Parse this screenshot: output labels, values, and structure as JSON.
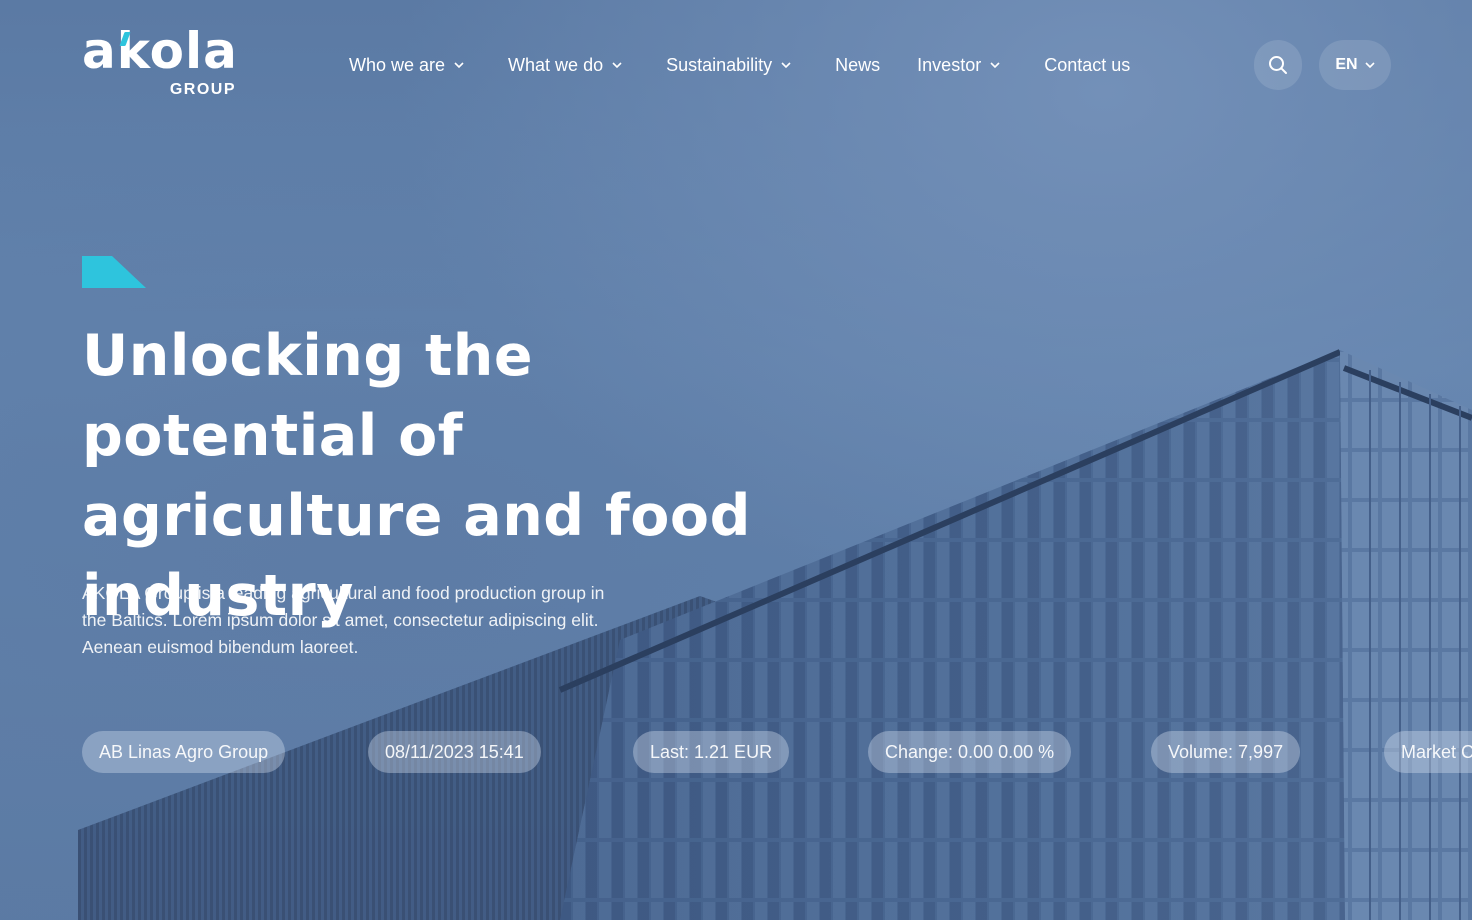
{
  "brand": {
    "logo_text": "akola",
    "logo_sub": "GROUP",
    "accent_color": "#2ec4dd"
  },
  "nav": {
    "items": [
      {
        "label": "Who we are",
        "dropdown": true
      },
      {
        "label": "What we do",
        "dropdown": true
      },
      {
        "label": "Sustainability",
        "dropdown": true
      },
      {
        "label": "News",
        "dropdown": false
      },
      {
        "label": "Investor",
        "dropdown": true
      },
      {
        "label": "Contact us",
        "dropdown": false
      }
    ],
    "search_icon": "search-icon",
    "language": "EN"
  },
  "hero": {
    "headline": "Unlocking the potential of agriculture and food industry",
    "intro": "AKOLA Group is a leading agricultural and food production group in the Baltics. Lorem ipsum dolor sit amet, consectetur adipiscing elit. Aenean euismod bibendum laoreet."
  },
  "ticker": {
    "company": "AB Linas Agro Group",
    "datetime": "08/11/2023 15:41",
    "last": "Last: 1.21 EUR",
    "change": "Change: 0.00 0.00 %",
    "volume": "Volume: 7,997",
    "market": "Market C"
  }
}
